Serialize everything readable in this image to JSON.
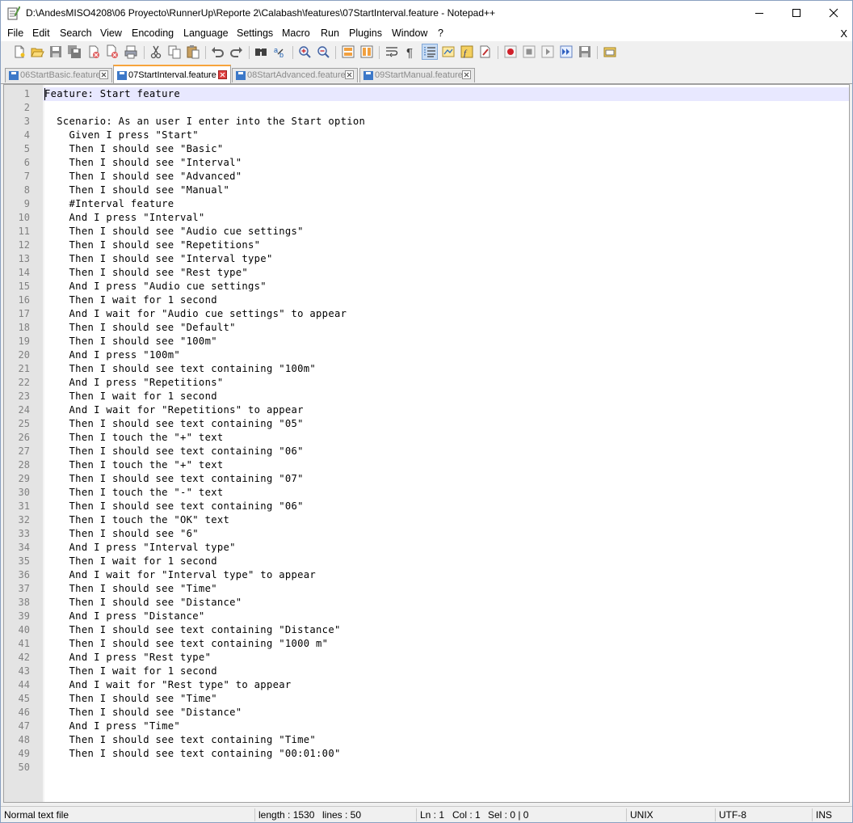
{
  "window": {
    "title": "D:\\AndesMISO4208\\06 Proyecto\\RunnerUp\\Reporte 2\\Calabash\\features\\07StartInterval.feature - Notepad++"
  },
  "menu": {
    "items": [
      "File",
      "Edit",
      "Search",
      "View",
      "Encoding",
      "Language",
      "Settings",
      "Macro",
      "Run",
      "Plugins",
      "Window",
      "?"
    ],
    "close": "X"
  },
  "tabs": [
    {
      "label": "06StartBasic.feature",
      "active": false
    },
    {
      "label": "07StartInterval.feature",
      "active": true
    },
    {
      "label": "08StartAdvanced.feature",
      "active": false
    },
    {
      "label": "09StartManual.feature",
      "active": false
    }
  ],
  "editor": {
    "lines": [
      {
        "n": "1",
        "text": "Feature: Start feature"
      },
      {
        "n": "2",
        "text": ""
      },
      {
        "n": "3",
        "text": "  Scenario: As an user I enter into the Start option"
      },
      {
        "n": "4",
        "text": "    Given I press \"Start\""
      },
      {
        "n": "5",
        "text": "    Then I should see \"Basic\""
      },
      {
        "n": "6",
        "text": "    Then I should see \"Interval\""
      },
      {
        "n": "7",
        "text": "    Then I should see \"Advanced\""
      },
      {
        "n": "8",
        "text": "    Then I should see \"Manual\""
      },
      {
        "n": "9",
        "text": "    #Interval feature"
      },
      {
        "n": "10",
        "text": "    And I press \"Interval\""
      },
      {
        "n": "11",
        "text": "    Then I should see \"Audio cue settings\""
      },
      {
        "n": "12",
        "text": "    Then I should see \"Repetitions\""
      },
      {
        "n": "13",
        "text": "    Then I should see \"Interval type\""
      },
      {
        "n": "14",
        "text": "    Then I should see \"Rest type\""
      },
      {
        "n": "15",
        "text": "    And I press \"Audio cue settings\""
      },
      {
        "n": "16",
        "text": "    Then I wait for 1 second"
      },
      {
        "n": "17",
        "text": "    And I wait for \"Audio cue settings\" to appear"
      },
      {
        "n": "18",
        "text": "    Then I should see \"Default\""
      },
      {
        "n": "19",
        "text": "    Then I should see \"100m\""
      },
      {
        "n": "20",
        "text": "    And I press \"100m\""
      },
      {
        "n": "21",
        "text": "    Then I should see text containing \"100m\""
      },
      {
        "n": "22",
        "text": "    And I press \"Repetitions\""
      },
      {
        "n": "23",
        "text": "    Then I wait for 1 second"
      },
      {
        "n": "24",
        "text": "    And I wait for \"Repetitions\" to appear"
      },
      {
        "n": "25",
        "text": "    Then I should see text containing \"05\""
      },
      {
        "n": "26",
        "text": "    Then I touch the \"+\" text"
      },
      {
        "n": "27",
        "text": "    Then I should see text containing \"06\""
      },
      {
        "n": "28",
        "text": "    Then I touch the \"+\" text"
      },
      {
        "n": "29",
        "text": "    Then I should see text containing \"07\""
      },
      {
        "n": "30",
        "text": "    Then I touch the \"-\" text"
      },
      {
        "n": "31",
        "text": "    Then I should see text containing \"06\""
      },
      {
        "n": "32",
        "text": "    Then I touch the \"OK\" text"
      },
      {
        "n": "33",
        "text": "    Then I should see \"6\""
      },
      {
        "n": "34",
        "text": "    And I press \"Interval type\""
      },
      {
        "n": "35",
        "text": "    Then I wait for 1 second"
      },
      {
        "n": "36",
        "text": "    And I wait for \"Interval type\" to appear"
      },
      {
        "n": "37",
        "text": "    Then I should see \"Time\""
      },
      {
        "n": "38",
        "text": "    Then I should see \"Distance\""
      },
      {
        "n": "39",
        "text": "    And I press \"Distance\""
      },
      {
        "n": "40",
        "text": "    Then I should see text containing \"Distance\""
      },
      {
        "n": "41",
        "text": "    Then I should see text containing \"1000 m\""
      },
      {
        "n": "42",
        "text": "    And I press \"Rest type\""
      },
      {
        "n": "43",
        "text": "    Then I wait for 1 second"
      },
      {
        "n": "44",
        "text": "    And I wait for \"Rest type\" to appear"
      },
      {
        "n": "45",
        "text": "    Then I should see \"Time\""
      },
      {
        "n": "46",
        "text": "    Then I should see \"Distance\""
      },
      {
        "n": "47",
        "text": "    And I press \"Time\""
      },
      {
        "n": "48",
        "text": "    Then I should see text containing \"Time\""
      },
      {
        "n": "49",
        "text": "    Then I should see text containing \"00:01:00\""
      },
      {
        "n": "50",
        "text": ""
      }
    ]
  },
  "status": {
    "filetype": "Normal text file",
    "length": "length : 1530",
    "lines": "lines : 50",
    "ln": "Ln : 1",
    "col": "Col : 1",
    "sel": "Sel : 0 | 0",
    "eol": "UNIX",
    "encoding": "UTF-8",
    "mode": "INS"
  },
  "toolbar_icons": [
    "new-file-icon",
    "open-file-icon",
    "save-icon",
    "save-all-icon",
    "close-icon",
    "close-all-icon",
    "print-icon",
    "cut-icon",
    "copy-icon",
    "paste-icon",
    "undo-icon",
    "redo-icon",
    "find-icon",
    "replace-icon",
    "zoom-in-icon",
    "zoom-out-icon",
    "sync-vertical-icon",
    "sync-horizontal-icon",
    "word-wrap-icon",
    "show-all-chars-icon",
    "indent-guide-icon",
    "doc-map-icon",
    "function-list-icon",
    "folder-as-workspace-icon",
    "record-macro-icon",
    "stop-record-icon",
    "play-macro-icon",
    "run-macro-multiple-icon",
    "save-macro-icon",
    "launch-browser-icon"
  ],
  "colors": {
    "current_line": "#e8e8ff",
    "gutter": "#e4e4e4",
    "active_tab_accent": "#f7a43c",
    "save_icon_blue": "#3c78c8",
    "record_red": "#d0202a"
  }
}
